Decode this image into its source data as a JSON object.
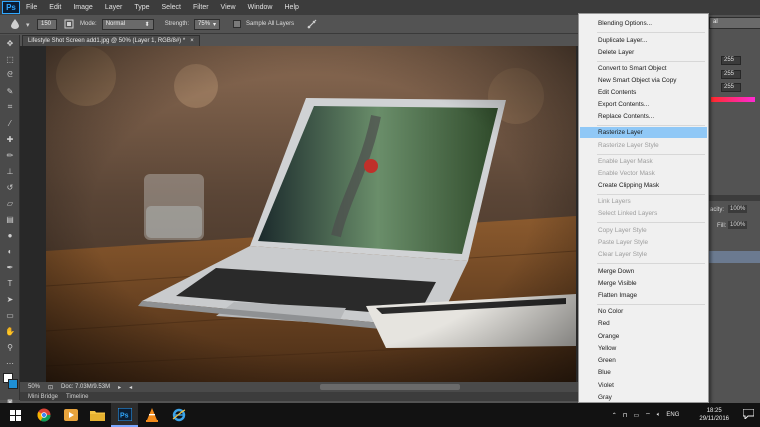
{
  "app": {
    "logo": "Ps"
  },
  "menubar": [
    "File",
    "Edit",
    "Image",
    "Layer",
    "Type",
    "Select",
    "Filter",
    "View",
    "Window",
    "Help"
  ],
  "options": {
    "brush_size": "150",
    "mode_label": "Mode:",
    "mode_value": "Normal",
    "strength_label": "Strength:",
    "strength_value": "75%",
    "sample_all_layers": "Sample All Layers"
  },
  "document_tab": {
    "title": "Lifestyle Shot Screen add1.jpg @ 50% (Layer 1, RGB/8#) *",
    "close": "×"
  },
  "statusbar": {
    "zoom": "50%",
    "doc_info": "Doc: 7.03M/9.53M"
  },
  "bottom_tabs": [
    "Mini Bridge",
    "Timeline"
  ],
  "right_panel": {
    "dropdown_value": "al",
    "fields": [
      "255",
      "255",
      "255"
    ],
    "opacity_label": "acity:",
    "opacity_value": "100%",
    "fill_label": "Fill:",
    "fill_value": "100%"
  },
  "context_menu": {
    "items": [
      {
        "label": "Blending Options...",
        "state": "enabled"
      },
      {
        "label": "Duplicate Layer...",
        "state": "enabled"
      },
      {
        "label": "Delete Layer",
        "state": "enabled"
      },
      {
        "label": "Convert to Smart Object",
        "state": "enabled"
      },
      {
        "label": "New Smart Object via Copy",
        "state": "enabled"
      },
      {
        "label": "Edit Contents",
        "state": "enabled"
      },
      {
        "label": "Export Contents...",
        "state": "enabled"
      },
      {
        "label": "Replace Contents...",
        "state": "enabled"
      },
      {
        "label": "Rasterize Layer",
        "state": "highlighted"
      },
      {
        "label": "Rasterize Layer Style",
        "state": "disabled"
      },
      {
        "label": "Enable Layer Mask",
        "state": "disabled"
      },
      {
        "label": "Enable Vector Mask",
        "state": "disabled"
      },
      {
        "label": "Create Clipping Mask",
        "state": "enabled"
      },
      {
        "label": "Link Layers",
        "state": "disabled"
      },
      {
        "label": "Select Linked Layers",
        "state": "disabled"
      },
      {
        "label": "Copy Layer Style",
        "state": "disabled"
      },
      {
        "label": "Paste Layer Style",
        "state": "disabled"
      },
      {
        "label": "Clear Layer Style",
        "state": "disabled"
      },
      {
        "label": "Merge Down",
        "state": "enabled"
      },
      {
        "label": "Merge Visible",
        "state": "enabled"
      },
      {
        "label": "Flatten Image",
        "state": "enabled"
      },
      {
        "label": "No Color",
        "state": "enabled"
      },
      {
        "label": "Red",
        "state": "enabled"
      },
      {
        "label": "Orange",
        "state": "enabled"
      },
      {
        "label": "Yellow",
        "state": "enabled"
      },
      {
        "label": "Green",
        "state": "enabled"
      },
      {
        "label": "Blue",
        "state": "enabled"
      },
      {
        "label": "Violet",
        "state": "enabled"
      },
      {
        "label": "Gray",
        "state": "enabled"
      }
    ]
  },
  "taskbar": {
    "apps": [
      "chrome-icon",
      "media-player-icon",
      "file-explorer-icon",
      "photoshop-icon",
      "vlc-icon",
      "internet-explorer-icon"
    ],
    "language": "ENG",
    "time": "18:25",
    "date": "29/11/2016"
  },
  "colors": {
    "menu_highlight": "#90c8f6",
    "ps_blue": "#31a8ff",
    "taskbar": "#121212"
  }
}
